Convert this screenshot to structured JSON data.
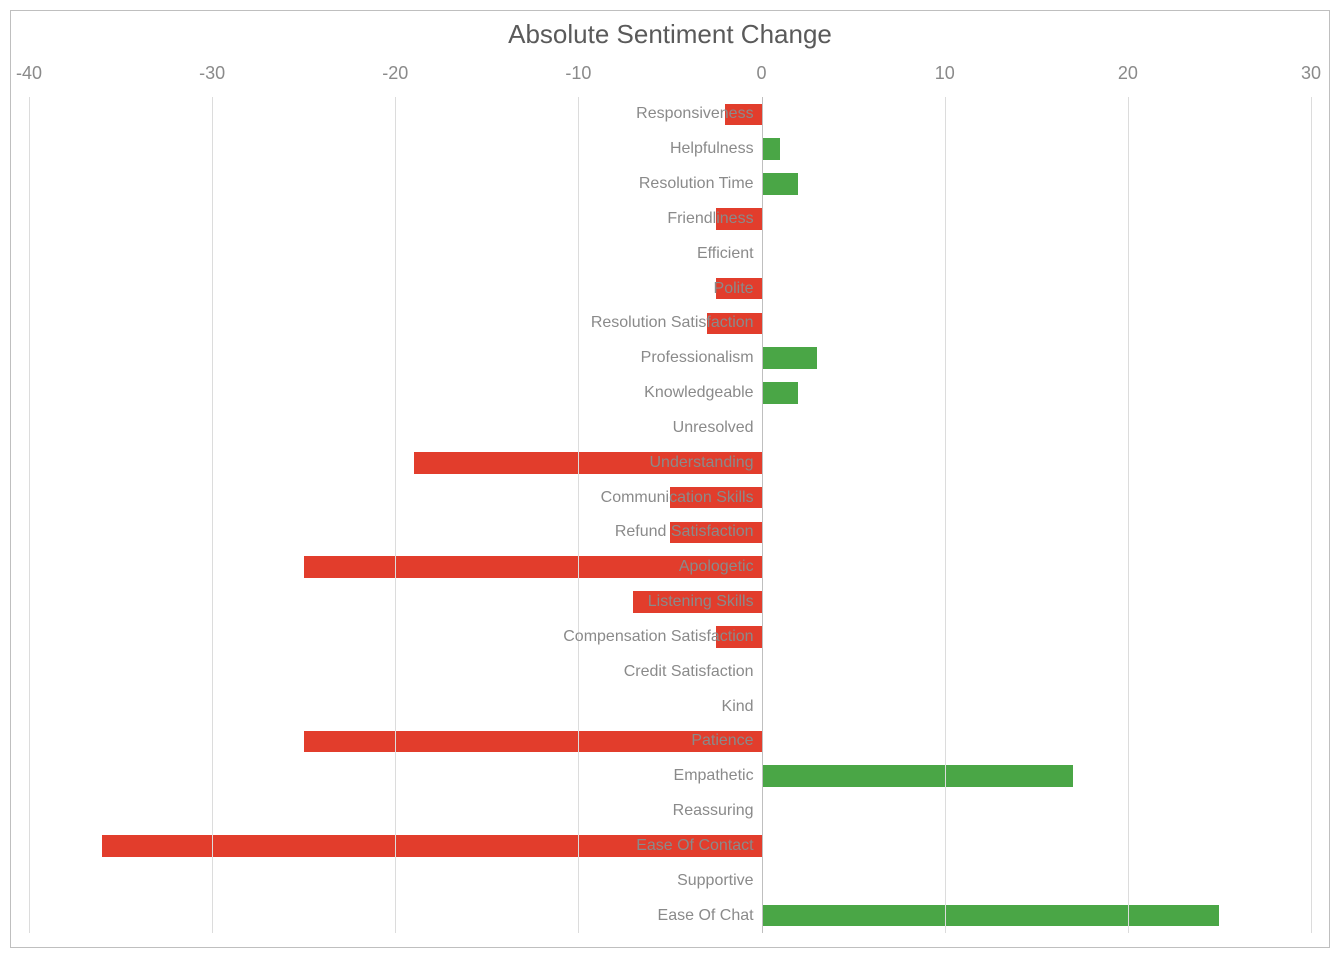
{
  "chart_data": {
    "type": "bar",
    "orientation": "horizontal",
    "title": "Absolute Sentiment Change",
    "xlabel": "",
    "ylabel": "",
    "xlim": [
      -40,
      30
    ],
    "ticks": [
      -40,
      -30,
      -20,
      -10,
      0,
      10,
      20,
      30
    ],
    "categories": [
      "Responsiveness",
      "Helpfulness",
      "Resolution Time",
      "Friendliness",
      "Efficient",
      "Polite",
      "Resolution Satisfaction",
      "Professionalism",
      "Knowledgeable",
      "Unresolved",
      "Understanding",
      "Communication Skills",
      "Refund Satisfaction",
      "Apologetic",
      "Listening Skills",
      "Compensation Satisfaction",
      "Credit Satisfaction",
      "Kind",
      "Patience",
      "Empathetic",
      "Reassuring",
      "Ease Of Contact",
      "Supportive",
      "Ease Of Chat"
    ],
    "values": [
      -2,
      1,
      2,
      -2.5,
      0,
      -2.5,
      -3,
      3,
      2,
      0,
      -19,
      -5,
      -5,
      -25,
      -7,
      -2.5,
      0,
      0,
      -25,
      17,
      0,
      -36,
      0,
      25
    ],
    "colors": {
      "positive": "#4aa646",
      "negative": "#e23d2c"
    }
  }
}
